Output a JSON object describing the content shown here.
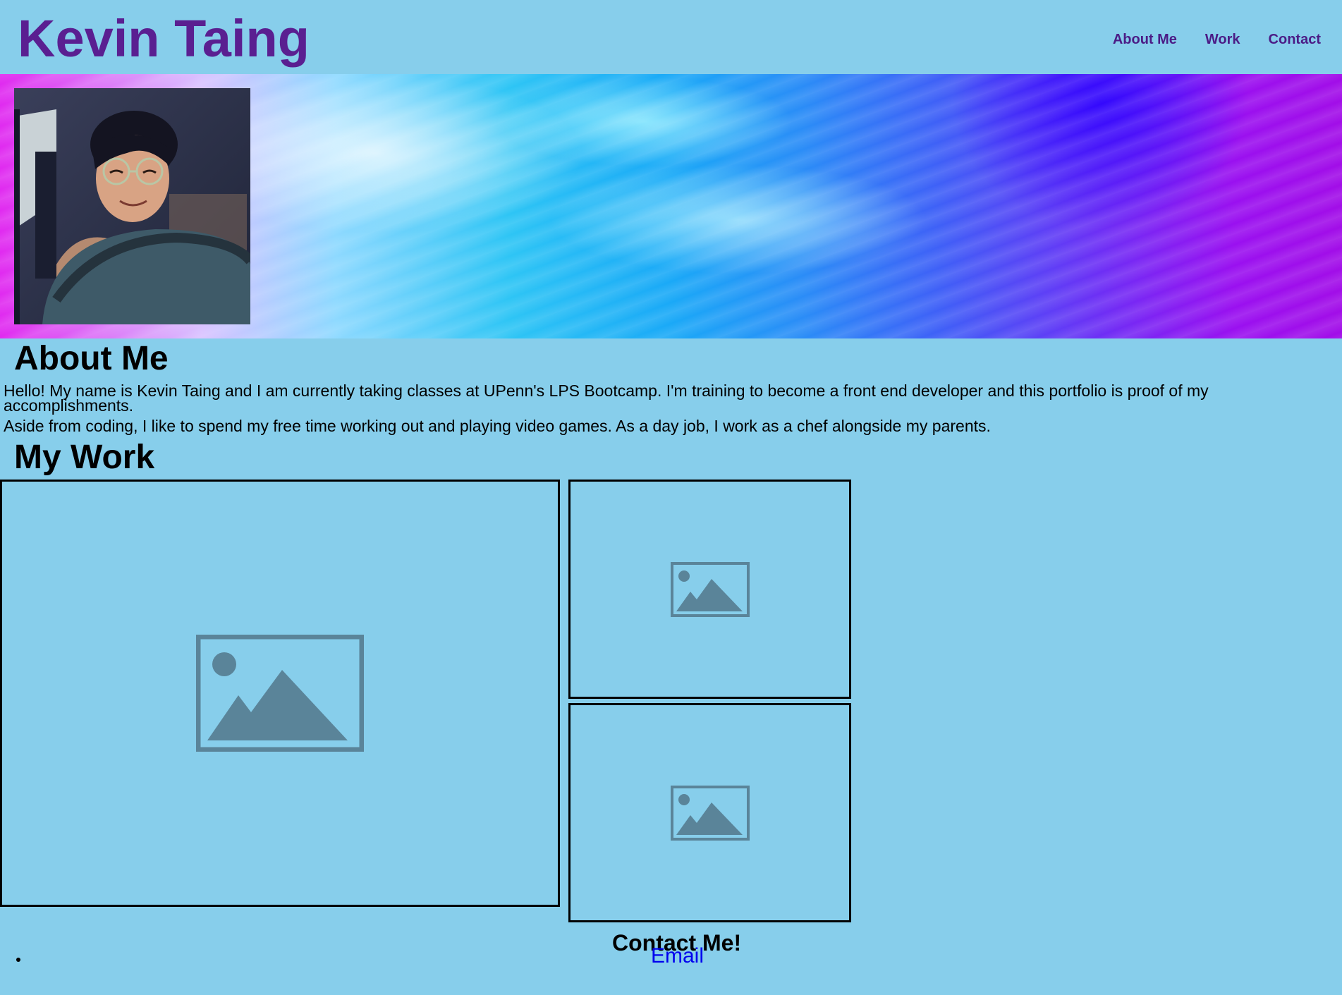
{
  "header": {
    "title": "Kevin Taing",
    "nav": {
      "about": "About Me",
      "work": "Work",
      "contact": "Contact"
    }
  },
  "hero": {
    "avatar_alt": "Photo of Kevin Taing"
  },
  "about": {
    "heading": "About Me",
    "paragraph1": "Hello! My name is Kevin Taing and I am currently taking classes at UPenn's LPS Bootcamp. I'm training to become a front end developer and this portfolio is proof of my accomplishments.",
    "paragraph2": "Aside from coding, I like to spend my free time working out and playing video games. As a day job, I work as a chef alongside my parents."
  },
  "work": {
    "heading": "My Work",
    "items": [
      {
        "icon": "image-placeholder-icon"
      },
      {
        "icon": "image-placeholder-icon"
      },
      {
        "icon": "image-placeholder-icon"
      }
    ]
  },
  "contact": {
    "heading": "Contact Me!",
    "email_label": "Email"
  },
  "colors": {
    "background": "#87ceeb",
    "title": "#5a1f91",
    "nav": "#4b1c86",
    "link": "#0000ee",
    "placeholder_icon": "#5a8499"
  }
}
